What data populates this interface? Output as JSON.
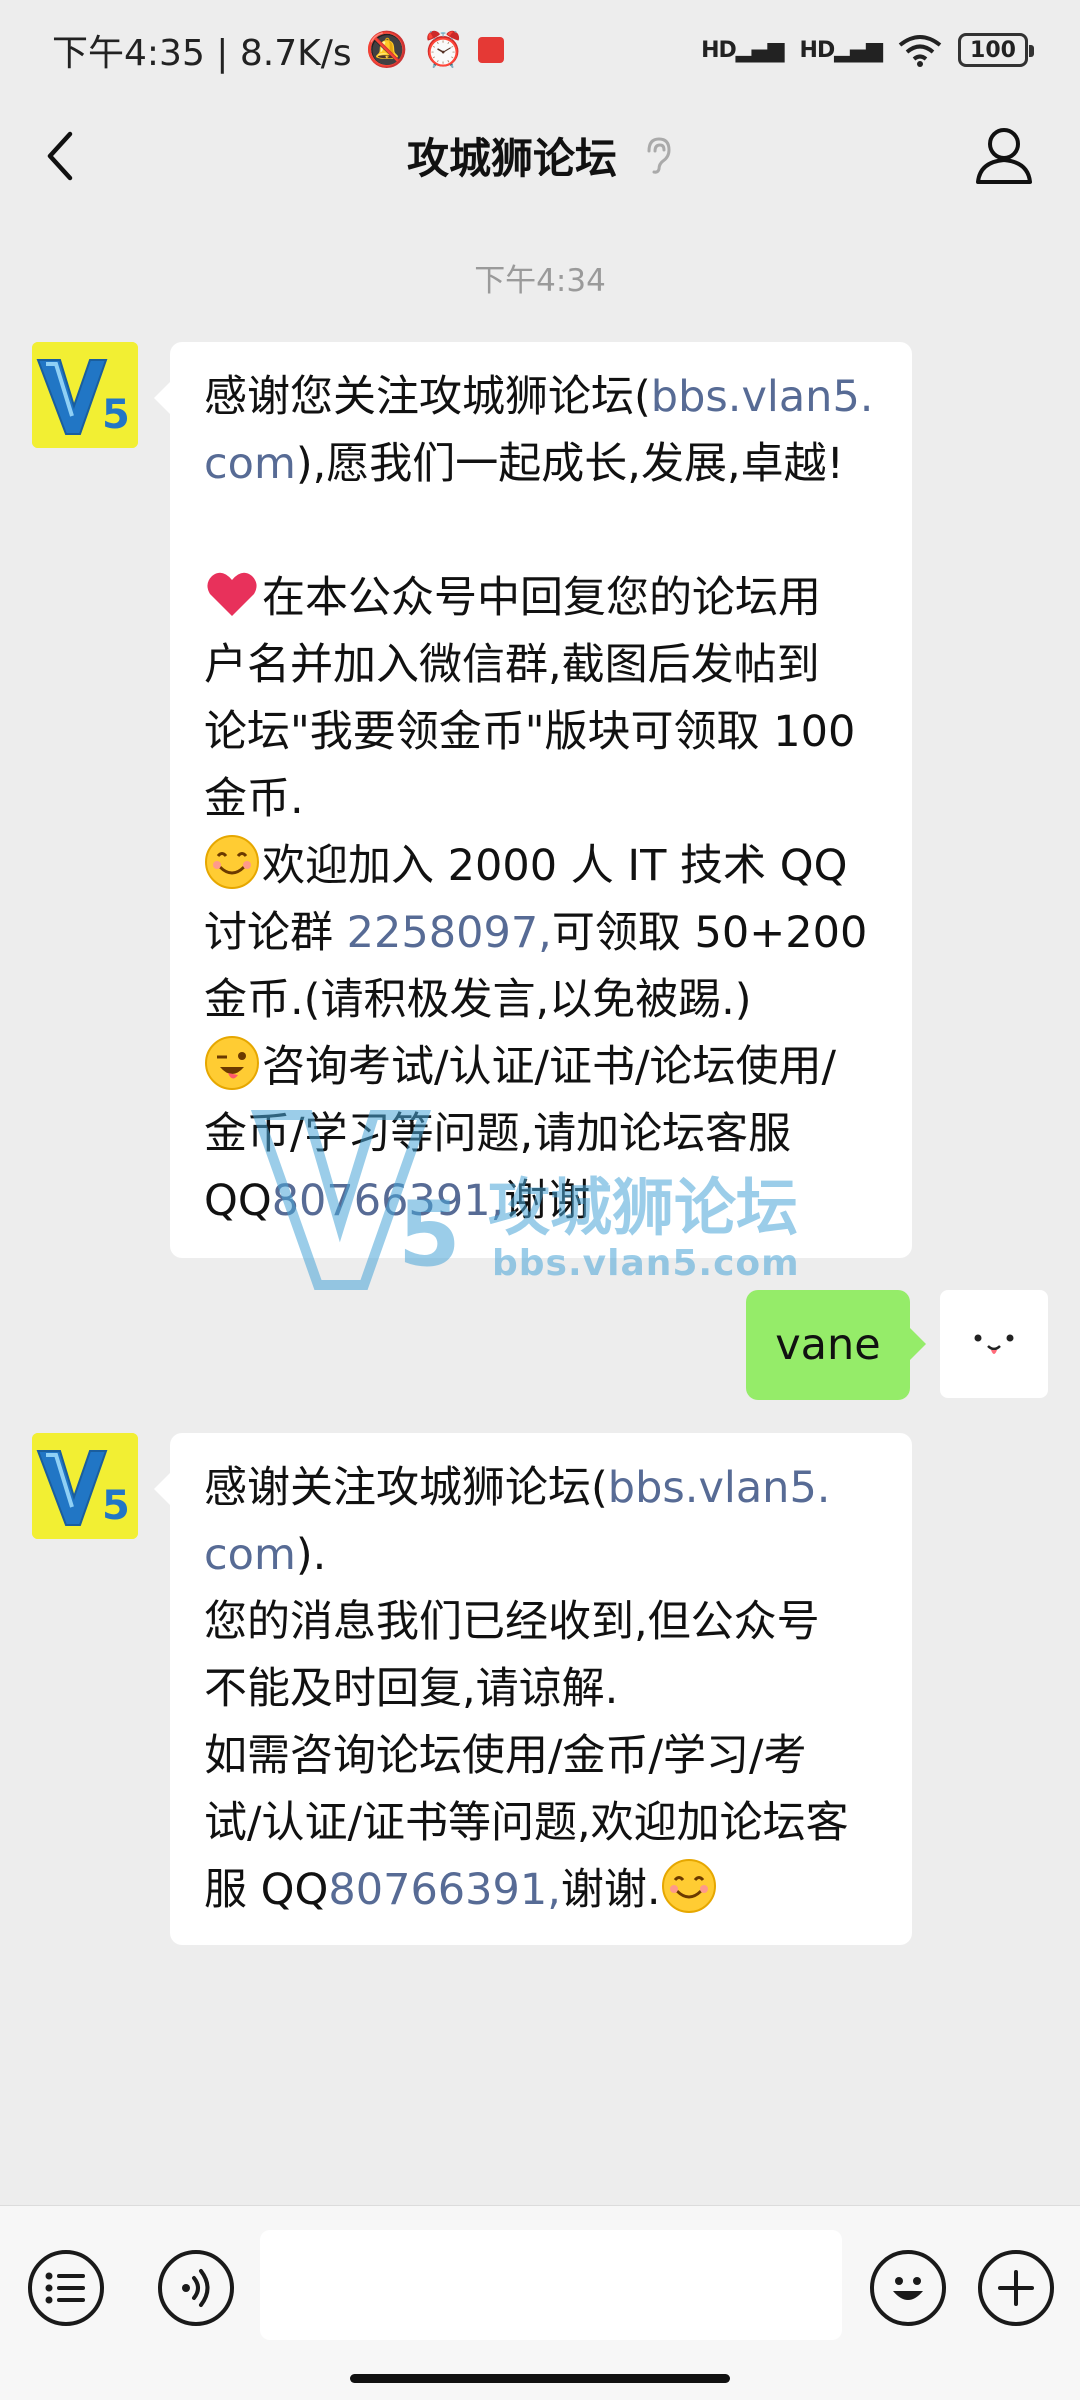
{
  "status_bar": {
    "time_speed": "下午4:35 | 8.7K/s",
    "battery": "100",
    "signal_labels": [
      "HD",
      "HD"
    ]
  },
  "header": {
    "title": "攻城狮论坛"
  },
  "chat": {
    "timestamp": "下午4:34",
    "message_1": {
      "line1_text": "感谢您关注攻城狮论坛(",
      "line1_link": "bbs.vlan5.",
      "line2_link": "com",
      "line2_text": "),愿我们一起成长,发展,卓越!",
      "line4": "在本公众号中回复您的论坛用",
      "line5": "户名并加入微信群,截图后发帖到",
      "line6": "论坛\"我要领金币\"版块可领取 100",
      "line7": "金币.",
      "line8": "欢迎加入 2000 人 IT 技术 QQ",
      "line9_text_a": "讨论群 ",
      "line9_link": "2258097,",
      "line9_text_b": "可领取 50+200",
      "line10": "金币.(请积极发言,以免被踢.)",
      "line11": "咨询考试/认证/证书/论坛使用/",
      "line12": "金币/学习等问题,请加论坛客服",
      "line13_text_a": "QQ",
      "line13_link": "80766391,",
      "line13_text_b": "谢谢"
    },
    "my_message": "vane",
    "message_2": {
      "line1_text": "感谢关注攻城狮论坛(",
      "line1_link": "bbs.vlan5.",
      "line2_link": "com",
      "line2_text": ").",
      "line3": "您的消息我们已经收到,但公众号",
      "line4": "不能及时回复,请谅解.",
      "line5": "如需咨询论坛使用/金币/学习/考",
      "line6": "试/认证/证书等问题,欢迎加论坛客",
      "line7_text_a": "服 QQ",
      "line7_link": "80766391,",
      "line7_text_b": "谢谢."
    }
  },
  "watermark": {
    "title": "攻城狮论坛",
    "url": "bbs.vlan5.com"
  },
  "colors": {
    "link": "#576b95",
    "my_bubble": "#95ec69",
    "background": "#ededed",
    "avatar_yellow": "#f2ef33"
  },
  "icons": [
    "back-icon",
    "ear-icon",
    "profile-icon",
    "menu-list-icon",
    "voice-icon",
    "emoji-icon",
    "plus-icon"
  ]
}
